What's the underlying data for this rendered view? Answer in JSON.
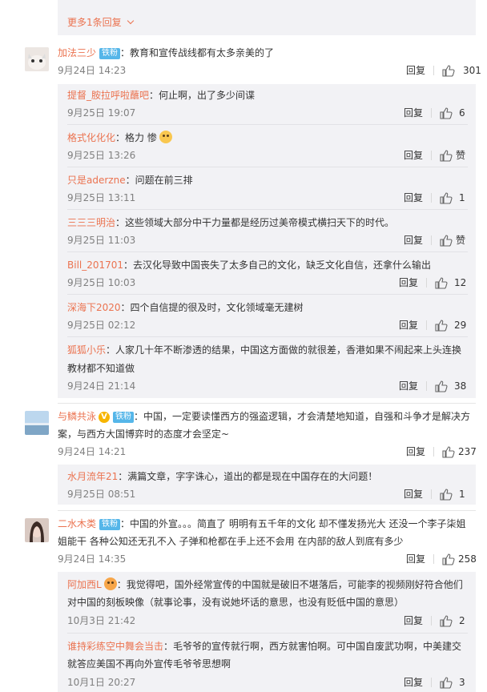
{
  "more_replies": "更多1条回复",
  "reply_label": "回复",
  "colors": {
    "username": "#eb7350",
    "badge": "#55b6e9",
    "nested_bg": "#f2f2f5"
  },
  "comments": [
    {
      "user": "加法三少",
      "badge": "铁粉",
      "text": "：教育和宣传战线都有太多亲美的了",
      "time": "9月24日 14:23",
      "likes": "301",
      "replies": [
        {
          "user": "提督_胺拉呼啦蘸吧",
          "text": "：何止啊，出了多少间谍",
          "time": "9月25日 19:07",
          "likes": "6"
        },
        {
          "user": "格式化化化",
          "text": "：格力 惨",
          "emoji": "cat-face-emoji",
          "time": "9月25日 13:26",
          "likes": "赞"
        },
        {
          "user": "只是aderzne",
          "text": "：问题在前三排",
          "time": "9月25日 13:11",
          "likes": "1"
        },
        {
          "user": "三三三明治",
          "text": "：这些领域大部分中干力量都是经历过美帝模式横扫天下的时代。",
          "time": "9月25日 11:03",
          "likes": "赞"
        },
        {
          "user": "Bill_201701",
          "text": "：去汉化导致中国丧失了太多自己的文化，缺乏文化自信，还拿什么输出",
          "time": "9月25日 10:03",
          "likes": "12"
        },
        {
          "user": "深海下2020",
          "text": "：四个自信提的很及时，文化领域毫无建树",
          "time": "9月25日 02:12",
          "likes": "29"
        },
        {
          "user": "狐狐小乐",
          "text": "：人家几十年不断渗透的结果，中国这方面做的就很差，香港如果不闹起来上头连换",
          "text2": "教材都不知道做",
          "time": "9月24日 21:14",
          "likes": "38"
        }
      ]
    },
    {
      "user": "与鳞共泳",
      "badge": "铁粉",
      "verified": "V",
      "text": "：中国，一定要读懂西方的强盗逻辑，才会清楚地知道，自强和斗争才是解决方",
      "text2": "案，与西方大国博弈时的态度才会坚定~",
      "time": "9月24日 14:21",
      "likes": "237",
      "replies": [
        {
          "user": "水月流年21",
          "text": "：满篇文章，字字诛心，道出的都是现在中国存在的大问题！",
          "time": "9月25日 08:51",
          "likes": "1"
        }
      ]
    },
    {
      "user": "二水木类",
      "badge": "铁粉",
      "text": "：中国的外宣。。。简直了 明明有五千年的文化 却不懂发扬光大 还没一个李子柒姐",
      "text2": "姐能干 各种公知还无孔不入 子弹和枪都在手上还不会用 在内部的敌人到底有多少",
      "time": "9月24日 14:35",
      "likes": "258",
      "replies": [
        {
          "user": "阿加西L",
          "text": "：我觉得吧，国外经常宣传的中国就是破旧不堪落后，可能李的视频刚好符合他们",
          "text2": "对中国的刻板映像（就事论事，没有说她坏话的意思，也没有贬低中国的意思）",
          "time": "10月3日 21:42",
          "likes": "2"
        },
        {
          "user": "谁持彩练空中舞会当击",
          "text": "：毛爷爷的宣传就行啊，西方就害怕啊。可中国自废武功啊，中美建交",
          "text2": "就答应美国不再向外宣传毛爷爷思想啊",
          "time": "10月1日 20:27",
          "likes": "3"
        }
      ]
    }
  ]
}
